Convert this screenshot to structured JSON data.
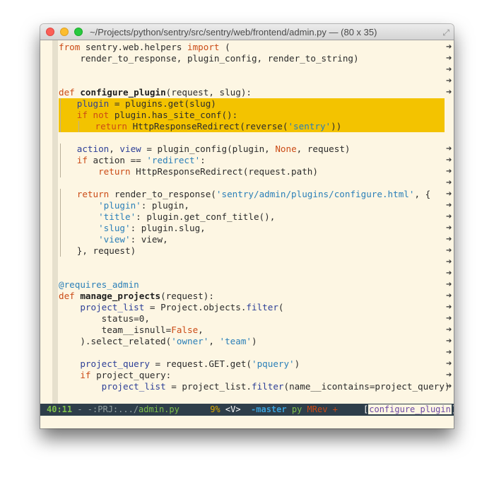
{
  "window": {
    "title": "~/Projects/python/sentry/src/sentry/web/frontend/admin.py  —  (80 x 35)",
    "resize_icon": "resize-diagonal-icon"
  },
  "code_lines": [
    [
      [
        "kw",
        "from"
      ],
      [
        "p",
        " sentry.web.helpers "
      ],
      [
        "kw",
        "import"
      ],
      [
        "p",
        " ("
      ]
    ],
    [
      [
        "p",
        "    render_to_response, plugin_config, render_to_string)"
      ]
    ],
    [],
    [],
    [
      [
        "kw",
        "def"
      ],
      [
        "p",
        " "
      ],
      [
        "name",
        "configure_plugin"
      ],
      [
        "p",
        "(request, slug):"
      ]
    ],
    [
      [
        "g"
      ],
      [
        "p",
        "   "
      ],
      [
        "var",
        "plugin"
      ],
      [
        "p",
        " = plugins.get(slug)"
      ]
    ],
    [
      [
        "g"
      ],
      [
        "p",
        "   "
      ],
      [
        "kw",
        "if not"
      ],
      [
        "p",
        " plugin.has_site_conf():"
      ]
    ],
    [
      [
        "g"
      ],
      [
        "p",
        "   "
      ],
      [
        "g"
      ],
      [
        "p",
        "   "
      ],
      [
        "kw",
        "return"
      ],
      [
        "p",
        " HttpResponseRedirect(reverse("
      ],
      [
        "str",
        "'sentry'"
      ],
      [
        "p",
        "))"
      ]
    ],
    [],
    [
      [
        "g"
      ],
      [
        "p",
        "   "
      ],
      [
        "var",
        "action"
      ],
      [
        "p",
        ", "
      ],
      [
        "var",
        "view"
      ],
      [
        "p",
        " = plugin_config(plugin, "
      ],
      [
        "const",
        "None"
      ],
      [
        "p",
        ", request)"
      ]
    ],
    [
      [
        "g"
      ],
      [
        "p",
        "   "
      ],
      [
        "kw",
        "if"
      ],
      [
        "p",
        " action == "
      ],
      [
        "str",
        "'redirect'"
      ],
      [
        "p",
        ":"
      ]
    ],
    [
      [
        "g"
      ],
      [
        "p",
        "       "
      ],
      [
        "kw",
        "return"
      ],
      [
        "p",
        " HttpResponseRedirect(request.path)"
      ]
    ],
    [],
    [
      [
        "g"
      ],
      [
        "p",
        "   "
      ],
      [
        "kw",
        "return"
      ],
      [
        "p",
        " render_to_response("
      ],
      [
        "str",
        "'sentry/admin/plugins/configure.html'"
      ],
      [
        "p",
        ", {"
      ]
    ],
    [
      [
        "g"
      ],
      [
        "p",
        "       "
      ],
      [
        "str",
        "'plugin'"
      ],
      [
        "p",
        ": plugin,"
      ]
    ],
    [
      [
        "g"
      ],
      [
        "p",
        "       "
      ],
      [
        "str",
        "'title'"
      ],
      [
        "p",
        ": plugin.get_conf_title(),"
      ]
    ],
    [
      [
        "g"
      ],
      [
        "p",
        "       "
      ],
      [
        "str",
        "'slug'"
      ],
      [
        "p",
        ": plugin.slug,"
      ]
    ],
    [
      [
        "g"
      ],
      [
        "p",
        "       "
      ],
      [
        "str",
        "'view'"
      ],
      [
        "p",
        ": view,"
      ]
    ],
    [
      [
        "g"
      ],
      [
        "p",
        "   }, request)"
      ]
    ],
    [],
    [],
    [
      [
        "dec",
        "@requires_admin"
      ]
    ],
    [
      [
        "kw",
        "def"
      ],
      [
        "p",
        " "
      ],
      [
        "name",
        "manage_projects"
      ],
      [
        "p",
        "(request):"
      ]
    ],
    [
      [
        "p",
        "    "
      ],
      [
        "var",
        "project_list"
      ],
      [
        "p",
        " = Project.objects."
      ],
      [
        "var",
        "filter"
      ],
      [
        "p",
        "("
      ]
    ],
    [
      [
        "p",
        "        status=0,"
      ]
    ],
    [
      [
        "p",
        "        team__isnull="
      ],
      [
        "const",
        "False"
      ],
      [
        "p",
        ","
      ]
    ],
    [
      [
        "p",
        "    ).select_related("
      ],
      [
        "str",
        "'owner'"
      ],
      [
        "p",
        ", "
      ],
      [
        "str",
        "'team'"
      ],
      [
        "p",
        ")"
      ]
    ],
    [],
    [
      [
        "p",
        "    "
      ],
      [
        "var",
        "project_query"
      ],
      [
        "p",
        " = request.GET.get("
      ],
      [
        "str",
        "'pquery'"
      ],
      [
        "p",
        ")"
      ]
    ],
    [
      [
        "p",
        "    "
      ],
      [
        "kw",
        "if"
      ],
      [
        "p",
        " project_query:"
      ]
    ],
    [
      [
        "p",
        "        "
      ],
      [
        "var",
        "project_list"
      ],
      [
        "p",
        " = project_list."
      ],
      [
        "var",
        "filter"
      ],
      [
        "p",
        "(name__icontains=project_query)"
      ]
    ]
  ],
  "highlight_rows": [
    5,
    6,
    7
  ],
  "arrow_rows": [
    0,
    1,
    2,
    3,
    4,
    9,
    10,
    11,
    12,
    13,
    14,
    15,
    16,
    17,
    18,
    19,
    20,
    21,
    22,
    23,
    24,
    25,
    26,
    27,
    28,
    29,
    30
  ],
  "arrow_glyph": "➔",
  "modeline": {
    "position": "40:11",
    "flags": " - -:PRJ:.../",
    "file": "admin.py",
    "percent": "9%",
    "mode": "<V>",
    "branch": "-master",
    "lang": "py",
    "minor": "MRev +",
    "function": "configure_plugin",
    "bracket_open": "[",
    "bracket_close": "]"
  },
  "colors": {
    "background": "#fdf6e3",
    "highlight": "#f3c300",
    "modeline": "#2e3e4a",
    "keyword": "#cb4b16",
    "string": "#2a7fb8"
  }
}
